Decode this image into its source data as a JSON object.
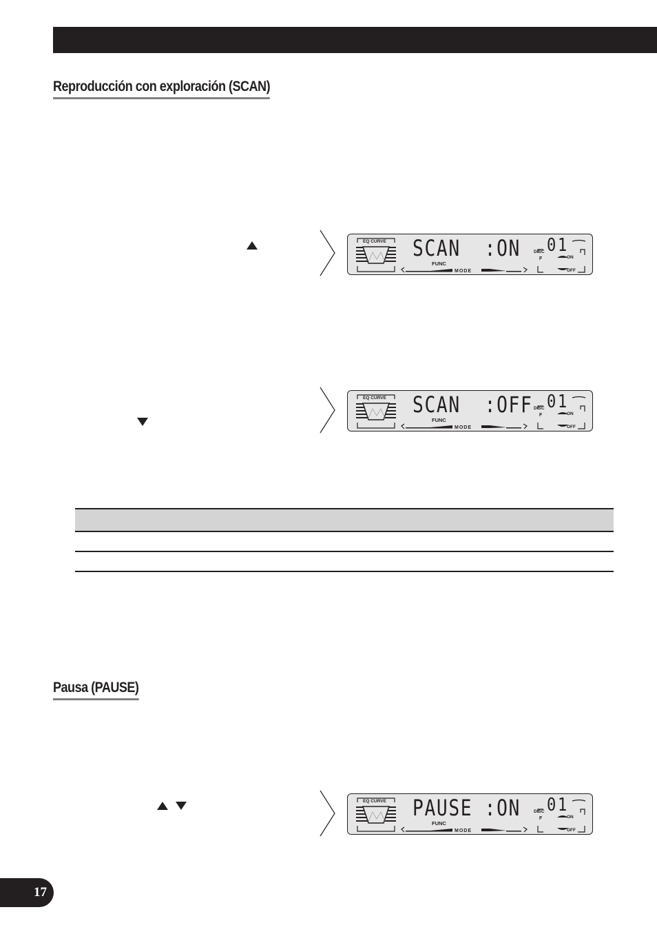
{
  "header": {
    "bar_color": "#231f20"
  },
  "sections": [
    {
      "heading": "Reproducción con exploración (SCAN)",
      "steps": [
        {
          "button_icon": "up-triangle-icon",
          "display": {
            "main": "SCAN",
            "status": ":ON",
            "eq_label": "EQ CURVE",
            "func_label": "FUNC",
            "mode_label": "MODE",
            "disc_label": "DISC",
            "disc_number": "01",
            "f_label": "F",
            "on_label": "ON",
            "off_label": "OFF"
          }
        },
        {
          "button_icon": "down-triangle-icon",
          "display": {
            "main": "SCAN",
            "status": ":OFF",
            "eq_label": "EQ CURVE",
            "func_label": "FUNC",
            "mode_label": "MODE",
            "disc_label": "DISC",
            "disc_number": "01",
            "f_label": "F",
            "on_label": "ON",
            "off_label": "OFF"
          }
        }
      ],
      "table": {
        "header": [
          ""
        ],
        "rows": [
          [
            ""
          ],
          [
            ""
          ]
        ]
      }
    },
    {
      "heading": "Pausa (PAUSE)",
      "steps": [
        {
          "button_icons": [
            "up-triangle-icon",
            "down-triangle-icon"
          ],
          "display": {
            "main": "PAUSE",
            "status": ":ON",
            "eq_label": "EQ CURVE",
            "func_label": "FUNC",
            "mode_label": "MODE",
            "disc_label": "DISC",
            "disc_number": "01",
            "f_label": "F",
            "on_label": "ON",
            "off_label": "OFF"
          }
        }
      ]
    }
  ],
  "footer": {
    "page_number": "17"
  }
}
